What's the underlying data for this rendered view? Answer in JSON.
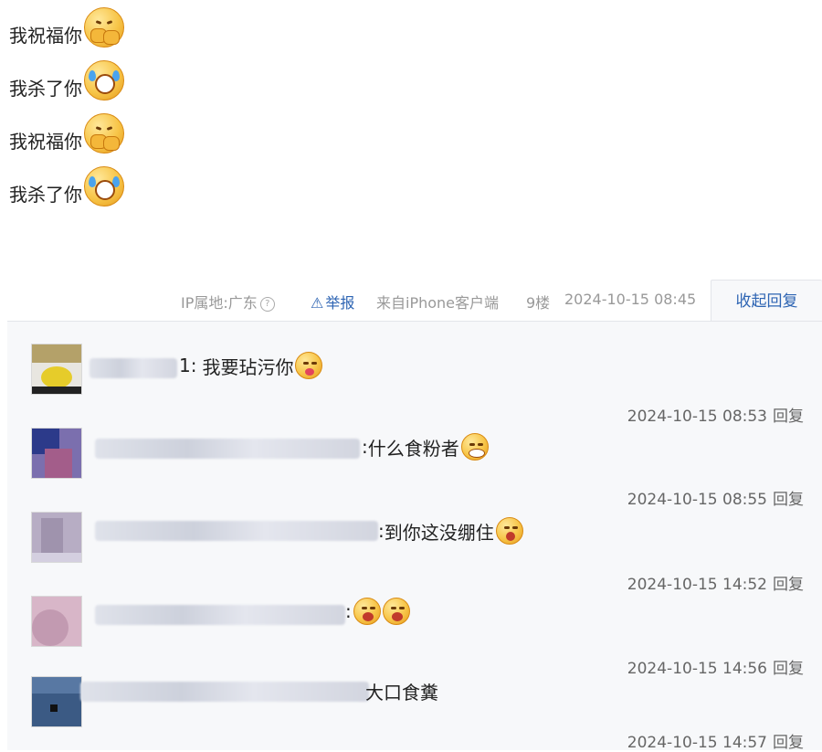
{
  "post": {
    "lines": [
      {
        "text": "我祝福你",
        "emoji": "blessing-face-emoji"
      },
      {
        "text": "我杀了你",
        "emoji": "crying-face-emoji"
      },
      {
        "text": "我祝福你",
        "emoji": "blessing-face-emoji"
      },
      {
        "text": "我杀了你",
        "emoji": "crying-face-emoji"
      }
    ]
  },
  "meta": {
    "ip_location": "IP属地:广东",
    "help_icon": "?",
    "report_label": "举报",
    "source": "来自iPhone客户端",
    "floor": "9楼",
    "timestamp": "2024-10-15 08:45",
    "collapse_label": "收起回复"
  },
  "replies": [
    {
      "prefix": "1:",
      "text": "我要玷污你",
      "emoji": [
        "tongue-face-emoji"
      ],
      "time": "2024-10-15 08:53",
      "reply_label": "回复"
    },
    {
      "prefix": ":",
      "text": "什么食粉者",
      "emoji": [
        "grin-face-emoji"
      ],
      "time": "2024-10-15 08:55",
      "reply_label": "回复"
    },
    {
      "prefix": ":",
      "text": "到你这没绷住",
      "emoji": [
        "surprised-face-emoji"
      ],
      "time": "2024-10-15 14:52",
      "reply_label": "回复"
    },
    {
      "prefix": ":",
      "text": "",
      "emoji": [
        "shocked-face-emoji",
        "shocked-face-emoji"
      ],
      "time": "2024-10-15 14:56",
      "reply_label": "回复"
    },
    {
      "prefix": "",
      "text": "大口食糞",
      "emoji": [],
      "time": "2024-10-15 14:57",
      "reply_label": "回复"
    }
  ]
}
